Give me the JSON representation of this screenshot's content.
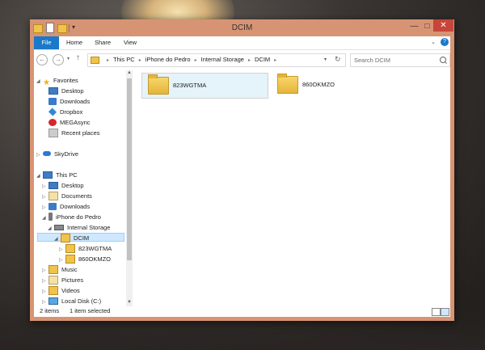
{
  "window": {
    "title": "DCIM",
    "accent": "#d79474",
    "minimize_glyph": "—",
    "maximize_glyph": "□",
    "close_glyph": "✕"
  },
  "ribbon": {
    "tabs": [
      "File",
      "Home",
      "Share",
      "View"
    ],
    "file_color": "#1979ca",
    "help_glyph": "?"
  },
  "address": {
    "crumbs": [
      "This PC",
      "iPhone do Pedro",
      "Internal Storage",
      "DCIM"
    ],
    "separator": "▸"
  },
  "search": {
    "placeholder": "Search DCIM"
  },
  "nav_tree": [
    {
      "label": "Favorites",
      "icon": "star-icon"
    },
    {
      "label": "Desktop",
      "icon": "desktop-icon"
    },
    {
      "label": "Downloads",
      "icon": "downloads-icon"
    },
    {
      "label": "Dropbox",
      "icon": "dropbox-icon"
    },
    {
      "label": "MEGAsync",
      "icon": "megasync-icon"
    },
    {
      "label": "Recent places",
      "icon": "recent-places-icon"
    },
    {
      "label": "SkyDrive",
      "icon": "skydrive-icon"
    },
    {
      "label": "This PC",
      "icon": "this-pc-icon"
    },
    {
      "label": "Desktop",
      "icon": "desktop-icon"
    },
    {
      "label": "Documents",
      "icon": "documents-icon"
    },
    {
      "label": "Downloads",
      "icon": "downloads-icon"
    },
    {
      "label": "iPhone do Pedro",
      "icon": "phone-icon"
    },
    {
      "label": "Internal Storage",
      "icon": "drive-icon"
    },
    {
      "label": "DCIM",
      "icon": "folder-icon",
      "selected": true
    },
    {
      "label": "823WGTMA",
      "icon": "folder-icon"
    },
    {
      "label": "860OKMZO",
      "icon": "folder-icon"
    },
    {
      "label": "Music",
      "icon": "music-icon"
    },
    {
      "label": "Pictures",
      "icon": "pictures-icon"
    },
    {
      "label": "Videos",
      "icon": "videos-icon"
    },
    {
      "label": "Local Disk (C:)",
      "icon": "local-disk-icon"
    }
  ],
  "files": [
    {
      "name": "823WGTMA",
      "selected": true
    },
    {
      "name": "860OKMZO",
      "selected": false
    }
  ],
  "status": {
    "count": "2 items",
    "selection": "1 item selected"
  }
}
